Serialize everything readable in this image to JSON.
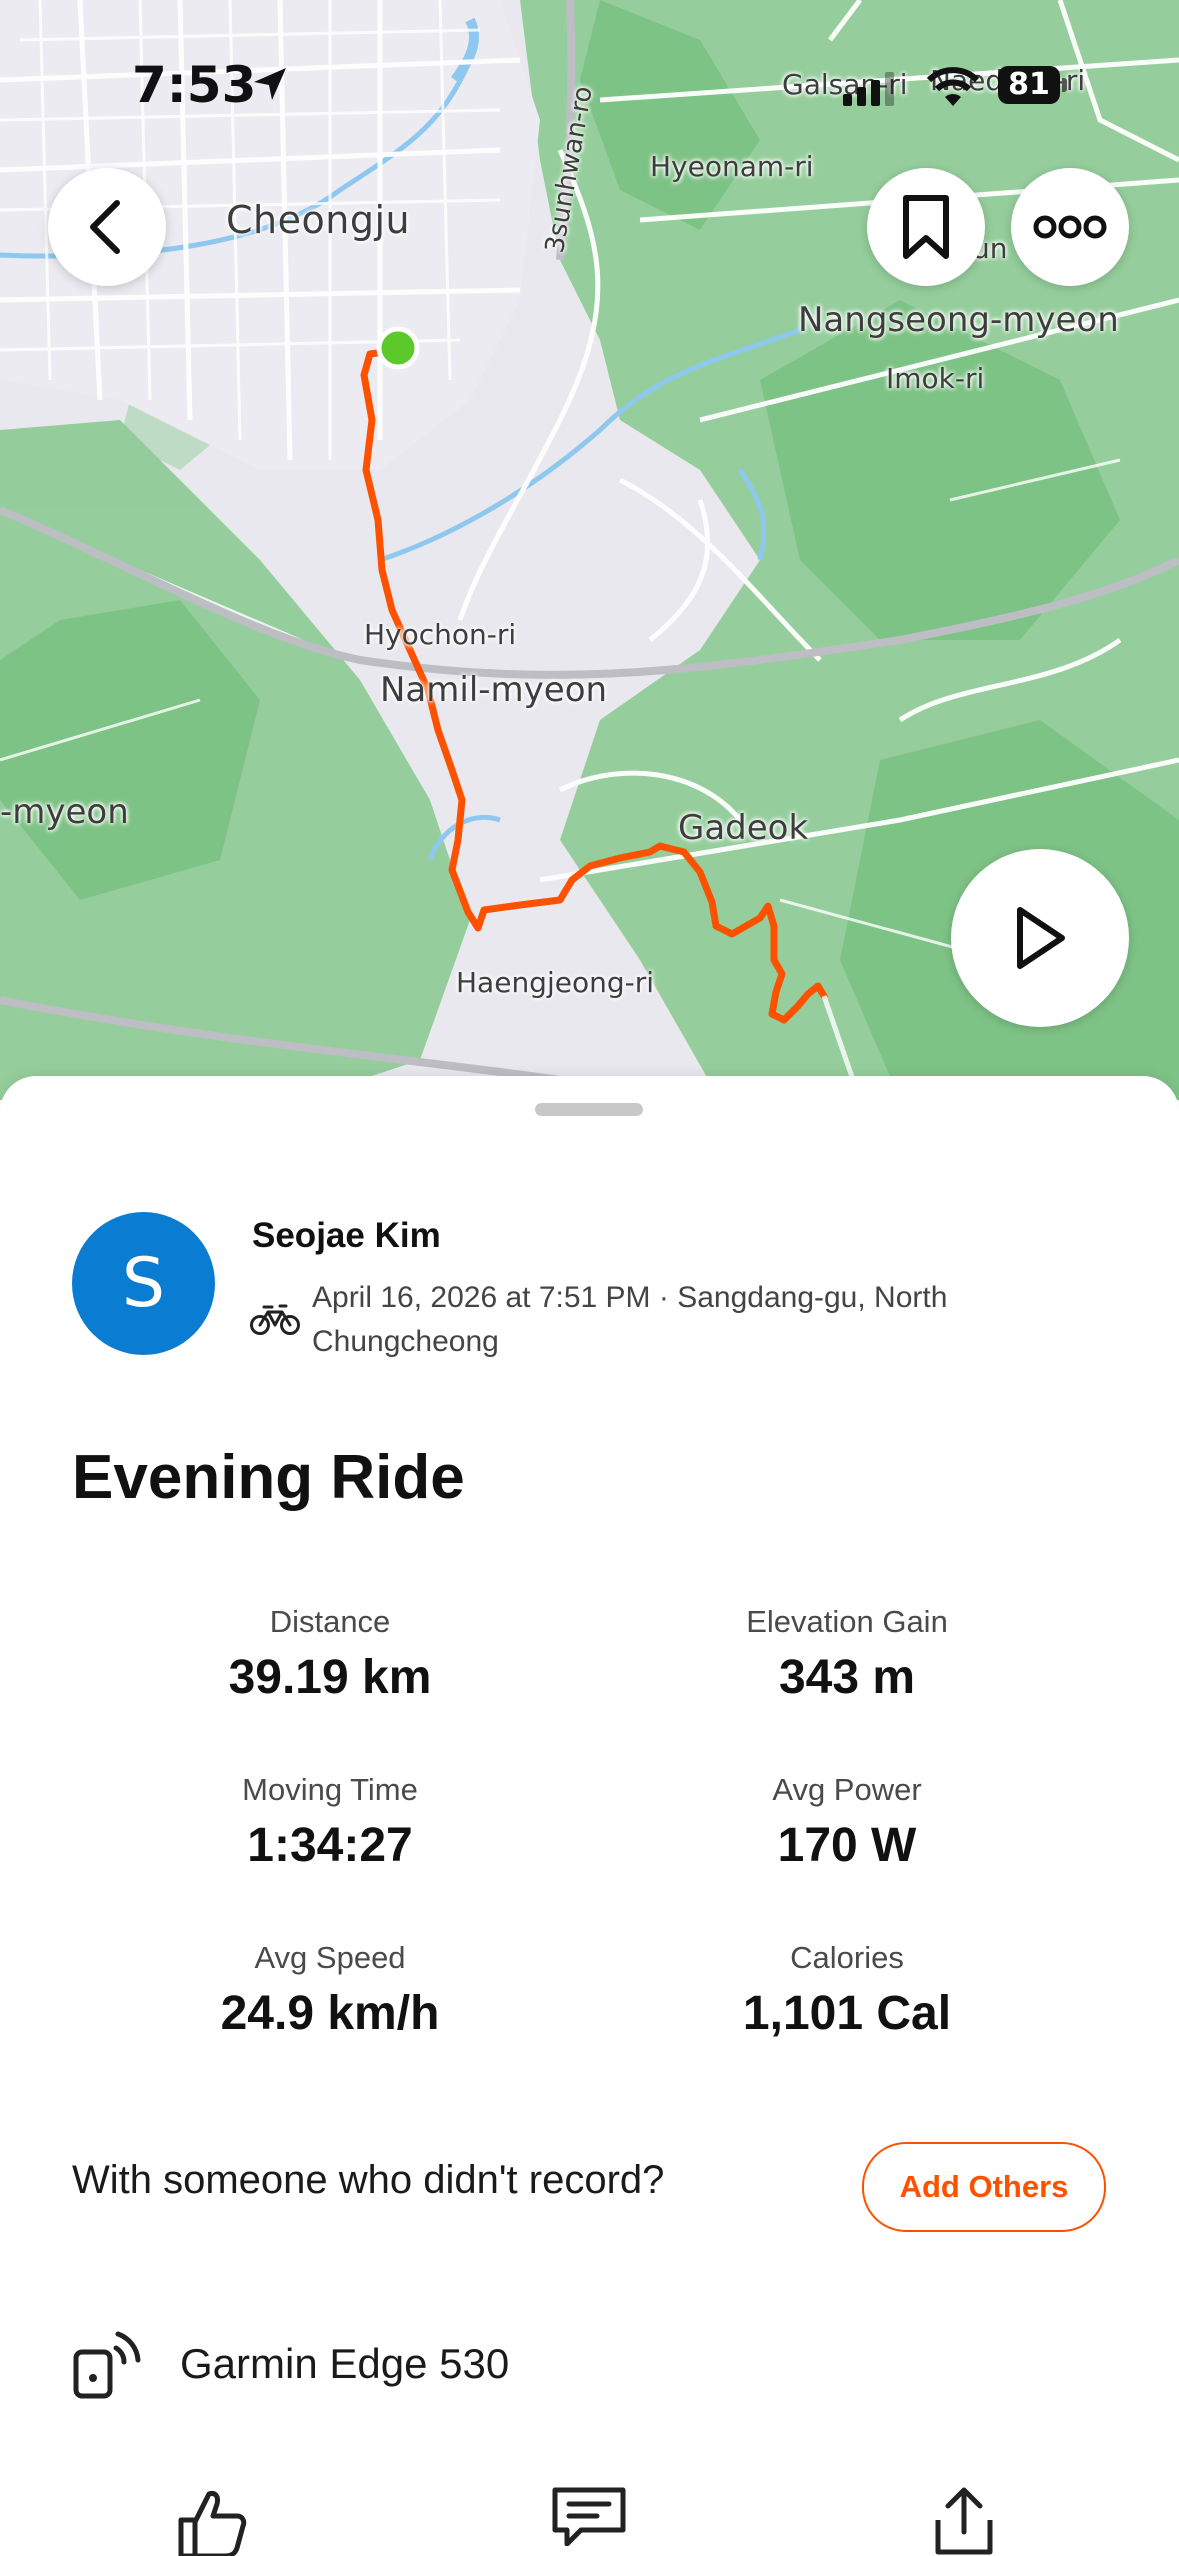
{
  "status_bar": {
    "time": "7:53",
    "battery": "81"
  },
  "map": {
    "labels": {
      "cheongju": "Cheongju",
      "sunhwan_ro": "3sunhwan-ro",
      "hyeonam_ri": "Hyeonam-ri",
      "galsan_ri": "Galsan-ri",
      "naedong_ri": "Naedong-ri",
      "nangseong_myeon": "Nangseong-myeon",
      "imok_ri": "Imok-ri",
      "gun": "un",
      "hyochon_ri": "Hyochon-ri",
      "namil_myeon": "Namil-myeon",
      "myeon_left": "-myeon",
      "gadeok": "Gadeok",
      "haengjeong_ri": "Haengjeong-ri"
    },
    "route_color": "#fc5200",
    "start_marker_color": "#5cc82a",
    "water_color": "#8fc8ef"
  },
  "controls": {
    "back": "back-icon",
    "bookmark": "bookmark-icon",
    "more": "more-icon",
    "play": "play-icon"
  },
  "athlete": {
    "avatar_initial": "S",
    "name": "Seojae Kim",
    "activity_type_icon": "bike-icon",
    "meta": "April 16, 2026 at 7:51 PM · Sangdang-gu, North Chungcheong"
  },
  "activity": {
    "title": "Evening Ride",
    "stats": [
      {
        "label": "Distance",
        "value": "39.19 km"
      },
      {
        "label": "Elevation Gain",
        "value": "343 m"
      },
      {
        "label": "Moving Time",
        "value": "1:34:27"
      },
      {
        "label": "Avg Power",
        "value": "170 W"
      },
      {
        "label": "Avg Speed",
        "value": "24.9 km/h"
      },
      {
        "label": "Calories",
        "value": "1,101 Cal"
      }
    ]
  },
  "others": {
    "prompt": "With someone who didn't record?",
    "button_label": "Add Others"
  },
  "device": {
    "name": "Garmin Edge 530"
  },
  "actions": [
    "kudos-icon",
    "comment-icon",
    "share-icon"
  ],
  "colors": {
    "accent": "#fc5200",
    "avatar_bg": "#0a7cd1"
  }
}
